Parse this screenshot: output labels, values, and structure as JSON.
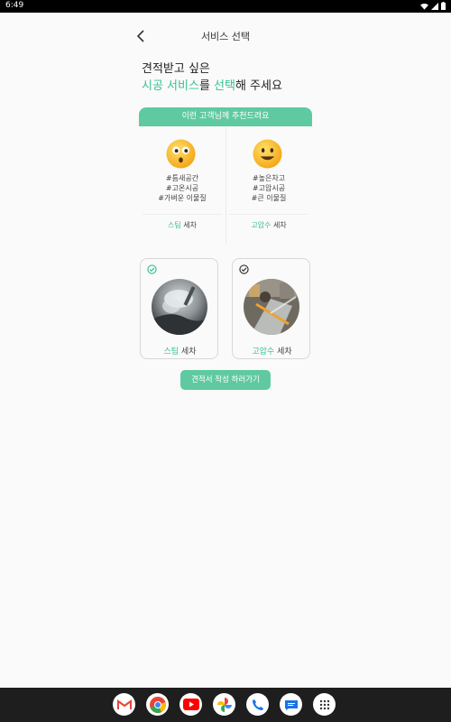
{
  "status_bar": {
    "time": "6:49"
  },
  "header": {
    "title": "서비스 선택"
  },
  "headline": {
    "line1": "견적받고 싶은",
    "line2_part1": "시공 서비스",
    "line2_part2": "를 ",
    "line2_part3": "선택",
    "line2_part4": "해 주세요"
  },
  "recommendation": {
    "title": "이런 고객님께 추천드려요",
    "columns": [
      {
        "tags": [
          "#틈새공간",
          "#고온시공",
          "#가벼운 이물질"
        ],
        "label_accent": "스팀",
        "label_rest": " 세차"
      },
      {
        "tags": [
          "#높은차고",
          "#고압시공",
          "#큰 이물질"
        ],
        "label_accent": "고압수",
        "label_rest": " 세차"
      }
    ]
  },
  "services": [
    {
      "label_accent": "스팀",
      "label_rest": " 세차",
      "selected": true
    },
    {
      "label_accent": "고압수",
      "label_rest": " 세차",
      "selected": false
    }
  ],
  "cta": {
    "label": "견적서 작성 하러가기"
  },
  "colors": {
    "accent": "#36c193",
    "header_green": "#5fcaa2"
  },
  "dock": [
    "gmail-icon",
    "chrome-icon",
    "youtube-icon",
    "photos-icon",
    "phone-icon",
    "messages-icon",
    "apps-icon"
  ]
}
